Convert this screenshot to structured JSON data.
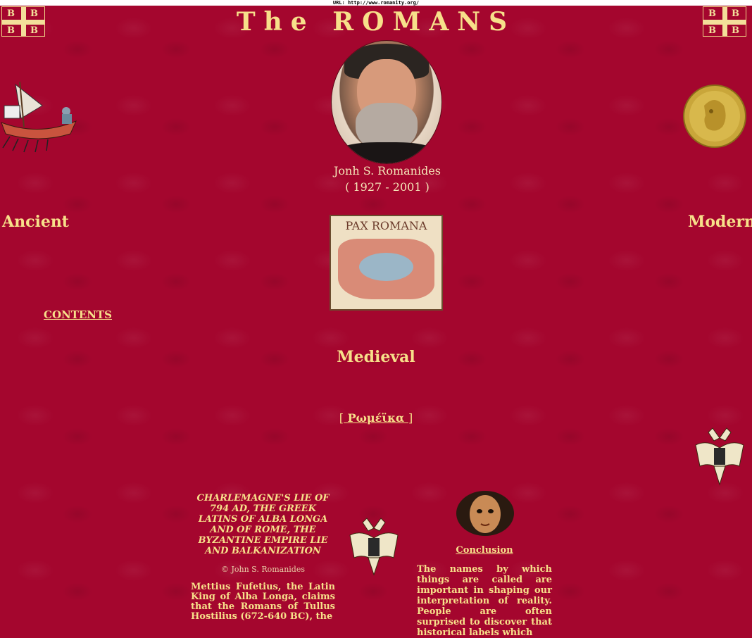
{
  "url_bar": "URL: http://www.romanity.org/",
  "title": "The ROMANS",
  "flag_letters": [
    "B",
    "B",
    "B",
    "B"
  ],
  "portrait_caption": {
    "name": "Jonh S. Romanides",
    "years": "( 1927 - 2001 )"
  },
  "sections": {
    "ancient": "Ancient",
    "modern": "Modern",
    "medieval": "Medieval"
  },
  "map_label": "PAX ROMANA",
  "contents_link": "CONTENTS",
  "greek_link": {
    "open": "[",
    "label": " Ρωμέϊκα ",
    "close": "]"
  },
  "article": {
    "heading": "CHARLEMAGNE'S LIE OF 794 AD, THE GREEK LATINS OF ALBA LONGA AND OF ROME, THE BYZANTINE EMPIRE LIE AND BALKANIZATION",
    "copyright": "© John S. Romanides",
    "body": "Mettius Fufetius, the Latin King of Alba Longa, claims that the Romans of Tullus Hostilius (672-640 BC), the"
  },
  "conclusion": {
    "link": "Conclusion",
    "body": "The names by which things are called are important in shaping our interpretation of reality. People are often surprised to discover that historical labels which"
  },
  "colors": {
    "background": "#a4062e",
    "text_gold": "#f7e08a"
  },
  "icons": [
    "byzantine-flag-icon",
    "galley-ship-icon",
    "gold-coin-icon",
    "double-headed-eagle-icon",
    "mosaic-face-icon"
  ]
}
